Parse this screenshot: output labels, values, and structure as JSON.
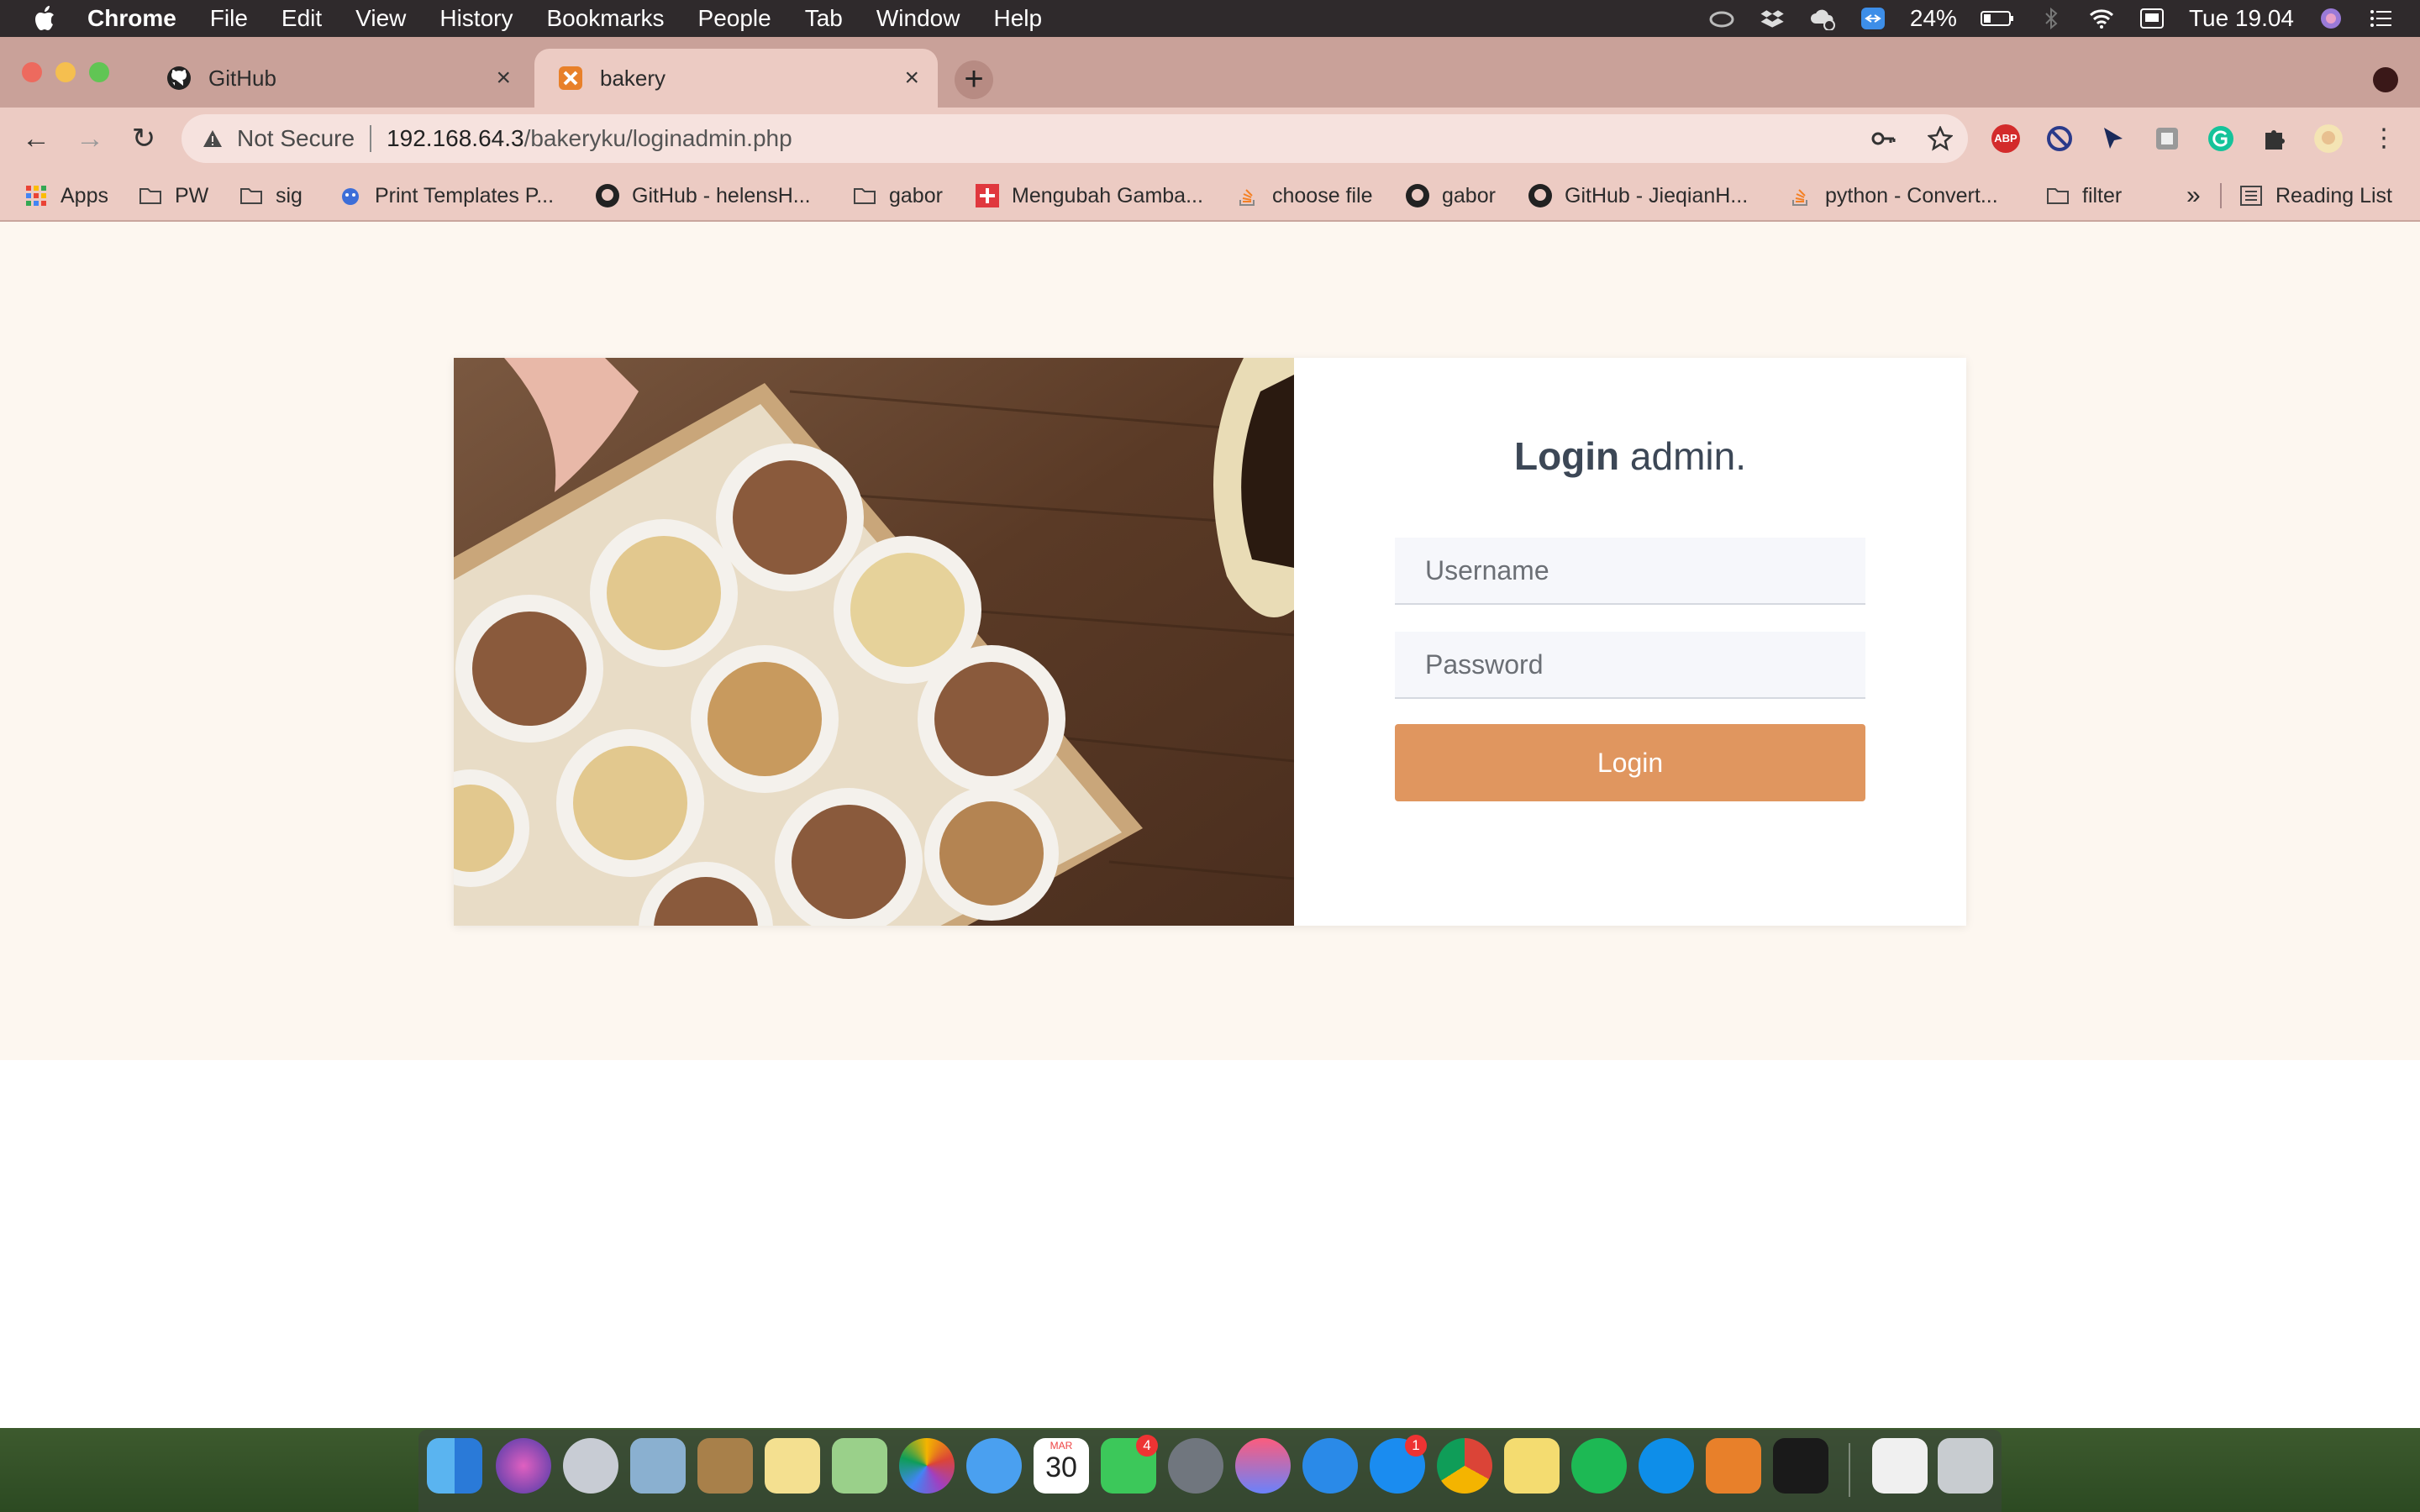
{
  "menubar": {
    "app": "Chrome",
    "items": [
      "File",
      "Edit",
      "View",
      "History",
      "Bookmarks",
      "People",
      "Tab",
      "Window",
      "Help"
    ],
    "battery": "24%",
    "clock": "Tue 19.04"
  },
  "tabs": [
    {
      "title": "GitHub",
      "close": "×"
    },
    {
      "title": "bakery",
      "close": "×"
    }
  ],
  "newtab": "+",
  "toolbar": {
    "back": "←",
    "forward": "→",
    "reload": "↻",
    "security": "Not Secure",
    "url_host": "192.168.64.3",
    "url_path": "/bakeryku/loginadmin.php"
  },
  "bookmarks": {
    "items": [
      "Apps",
      "PW",
      "sig",
      "Print Templates P...",
      "GitHub - helensH...",
      "gabor",
      "Mengubah Gamba...",
      "choose file",
      "gabor",
      "GitHub - JieqianH...",
      "python - Convert...",
      "filter"
    ],
    "overflow": "»",
    "reading_list": "Reading List"
  },
  "login": {
    "title_bold": "Login",
    "title_rest": " admin.",
    "username_placeholder": "Username",
    "password_placeholder": "Password",
    "button": "Login"
  },
  "dock": {
    "facetime_badge": "4",
    "appstore_badge": "1",
    "calendar_month": "MAR",
    "calendar_day": "30"
  },
  "colors": {
    "accent": "#e0965f",
    "page_bg": "#fdf7f0",
    "chrome_frame": "#c9a199",
    "title_text": "#3c4756"
  }
}
